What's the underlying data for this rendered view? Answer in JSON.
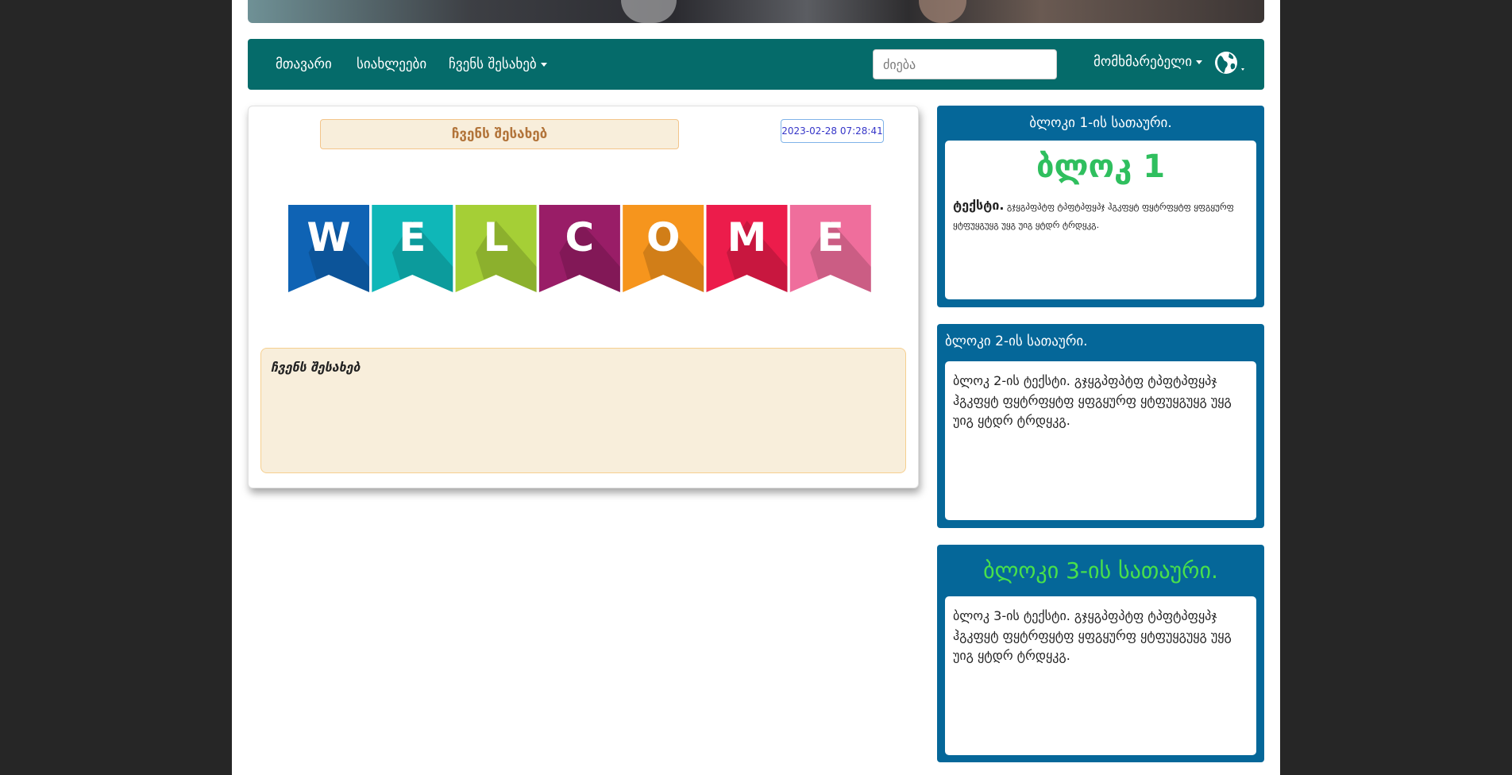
{
  "nav": {
    "home": "მთავარი",
    "news": "სიახლეები",
    "about": "ჩვენს შესახებ",
    "search_placeholder": "ძიება",
    "user": "მომხმარებელი"
  },
  "main": {
    "title": "ჩვენს შესახებ",
    "date": "2023-02-28 07:28:41",
    "welcome_letters": [
      "W",
      "E",
      "L",
      "C",
      "O",
      "M",
      "E"
    ],
    "welcome_colors": [
      "#0f63b4",
      "#0fb7b8",
      "#a5cf36",
      "#991d67",
      "#f6951d",
      "#ec1c4b",
      "#ef6e9c"
    ],
    "info_heading": "ჩვენს შესახებ"
  },
  "blocks": {
    "b1": {
      "title": "ბლოკი 1-ის სათაური.",
      "big": "ბლოკ 1",
      "bold": "ტექსტი.",
      "text": " გჯყგპფპტფ ტპფტპფყპჯ ჰგკფყტ ფყტრფყტფ ყფგყურფ ყტფუყგუყგ უყგ უიგ ყტდრ ტრდყკგ."
    },
    "b2": {
      "title": "ბლოკი 2-ის სათაური.",
      "text": "ბლოკ 2-ის ტექსტი. გჯყგპფპტფ ტპფტპფყპჯ ჰგკფყტ ფყტრფყტფ ყფგყურფ ყტფუყგუყგ უყგ უიგ ყტდრ ტრდყკგ."
    },
    "b3": {
      "title": "ბლოკი 3-ის სათაური.",
      "text": "ბლოკ 3-ის ტექსტი. გჯყგპფპტფ ტპფტპფყპჯ ჰგკფყტ ფყტრფყტფ ყფგყურფ ყტფუყგუყგ უყგ უიგ ყტდრ ტრდყკგ."
    }
  }
}
